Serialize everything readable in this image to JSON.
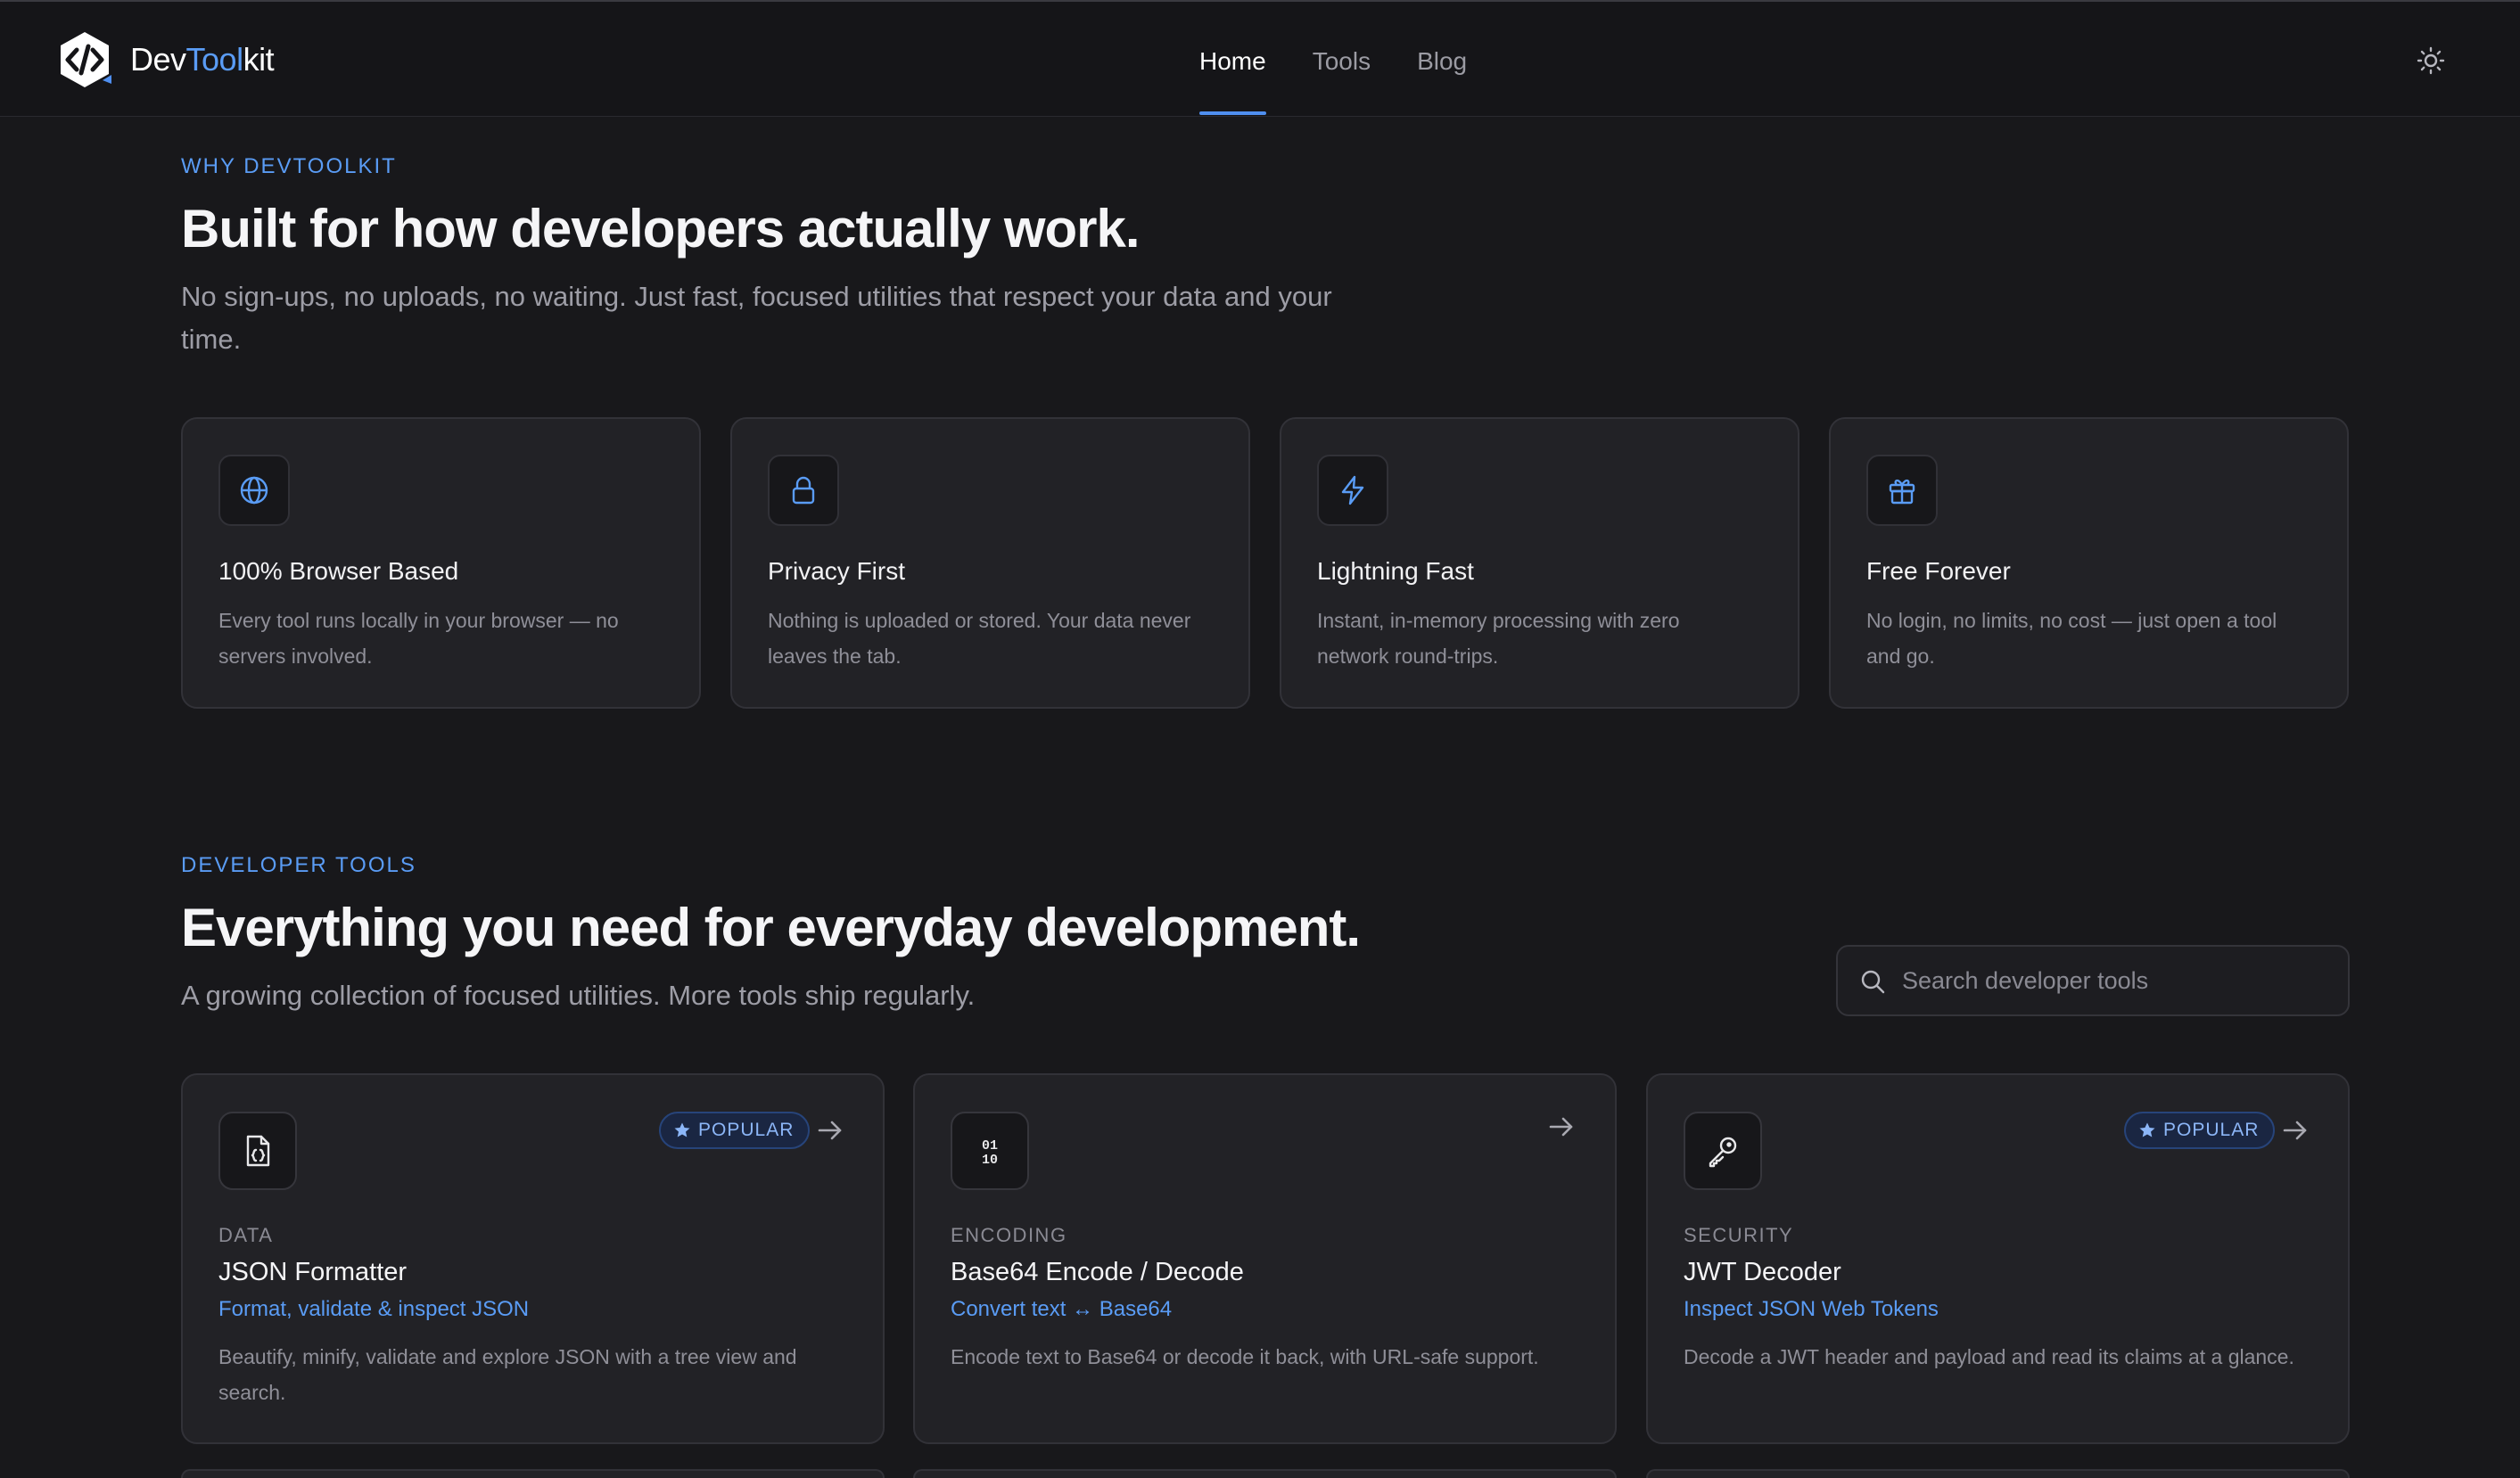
{
  "header": {
    "brand_prefix": "Dev",
    "brand_accent": "Tool",
    "brand_suffix": "kit",
    "nav": [
      {
        "label": "Home",
        "active": true
      },
      {
        "label": "Tools",
        "active": false
      },
      {
        "label": "Blog",
        "active": false
      }
    ],
    "theme_toggle_icon": "sun-icon"
  },
  "why": {
    "eyebrow": "WHY DEVTOOLKIT",
    "title": "Built for how developers actually work.",
    "subtitle_line1": "No sign-ups, no uploads, no waiting. Just fast, focused utilities that respect your data and your",
    "subtitle_line2": "time.",
    "features": [
      {
        "icon": "globe-icon",
        "title": "100% Browser Based",
        "desc_line1": "Every tool runs locally in your browser — no",
        "desc_line2": "servers involved."
      },
      {
        "icon": "lock-icon",
        "title": "Privacy First",
        "desc_line1": "Nothing is uploaded or stored. Your data never",
        "desc_line2": "leaves the tab."
      },
      {
        "icon": "lightning-icon",
        "title": "Lightning Fast",
        "desc_line1": "Instant, in-memory processing with zero",
        "desc_line2": "network round-trips."
      },
      {
        "icon": "gift-icon",
        "title": "Free Forever",
        "desc_line1": "No login, no limits, no cost — just open a tool",
        "desc_line2": "and go."
      }
    ]
  },
  "tools": {
    "eyebrow": "DEVELOPER TOOLS",
    "title": "Everything you need for everyday development.",
    "subtitle": "A growing collection of focused utilities. More tools ship regularly.",
    "search_placeholder": "Search developer tools",
    "popular_label": "POPULAR",
    "cards": [
      {
        "icon": "json-file-icon",
        "popular": true,
        "category": "DATA",
        "title": "JSON Formatter",
        "tagline": "Format, validate & inspect JSON",
        "desc_line1": "Beautify, minify, validate and explore JSON with a tree view and",
        "desc_line2": "search."
      },
      {
        "icon": "binary-icon",
        "popular": false,
        "category": "ENCODING",
        "title": "Base64 Encode / Decode",
        "tagline": "Convert text ↔ Base64",
        "desc_line1": "Encode text to Base64 or decode it back, with URL-safe support.",
        "desc_line2": ""
      },
      {
        "icon": "key-icon",
        "popular": true,
        "category": "SECURITY",
        "title": "JWT Decoder",
        "tagline": "Inspect JSON Web Tokens",
        "desc_line1": "Decode a JWT header and payload and read its claims at a glance.",
        "desc_line2": ""
      }
    ]
  },
  "colors": {
    "background": "#18181b",
    "card": "#222226",
    "accent": "#5a9cf5"
  }
}
